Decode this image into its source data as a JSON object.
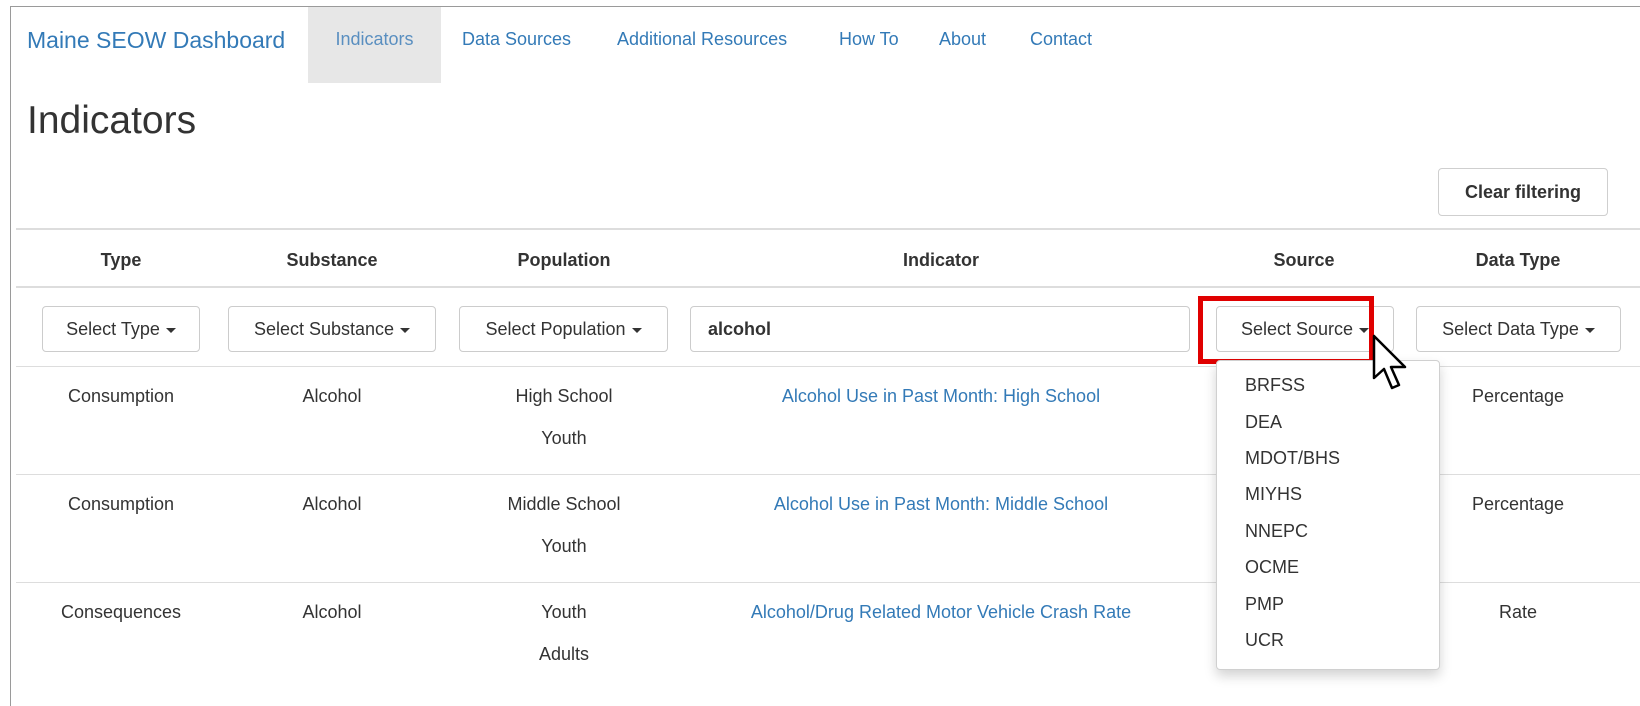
{
  "navbar": {
    "brand": "Maine SEOW Dashboard",
    "items": [
      {
        "label": "Indicators",
        "active": true
      },
      {
        "label": "Data Sources"
      },
      {
        "label": "Additional Resources"
      },
      {
        "label": "How To"
      },
      {
        "label": "About"
      },
      {
        "label": "Contact"
      }
    ]
  },
  "page": {
    "title": "Indicators",
    "clear_label": "Clear filtering"
  },
  "table": {
    "headers": [
      "Type",
      "Substance",
      "Population",
      "Indicator",
      "Source",
      "Data Type"
    ],
    "filters": {
      "type": "Select Type",
      "substance": "Select Substance",
      "population": "Select Population",
      "indicator_value": "alcohol",
      "source": "Select Source",
      "data_type": "Select Data Type"
    },
    "rows": [
      {
        "type": "Consumption",
        "substance": "Alcohol",
        "population": [
          "High School",
          "Youth"
        ],
        "indicator": "Alcohol Use in Past Month: High School",
        "data_type": "Percentage"
      },
      {
        "type": "Consumption",
        "substance": "Alcohol",
        "population": [
          "Middle School",
          "Youth"
        ],
        "indicator": "Alcohol Use in Past Month: Middle School",
        "data_type": "Percentage"
      },
      {
        "type": "Consequences",
        "substance": "Alcohol",
        "population": [
          "Youth",
          "Adults"
        ],
        "indicator": "Alcohol/Drug Related Motor Vehicle Crash Rate",
        "data_type": "Rate"
      }
    ]
  },
  "source_dropdown": {
    "options": [
      "BRFSS",
      "DEA",
      "MDOT/BHS",
      "MIYHS",
      "NNEPC",
      "OCME",
      "PMP",
      "UCR"
    ]
  },
  "colors": {
    "link": "#337ab7",
    "highlight": "#e00000",
    "active_nav_bg": "#e7e7e7"
  },
  "icons": [
    "caret-down-icon",
    "mouse-pointer-icon"
  ]
}
